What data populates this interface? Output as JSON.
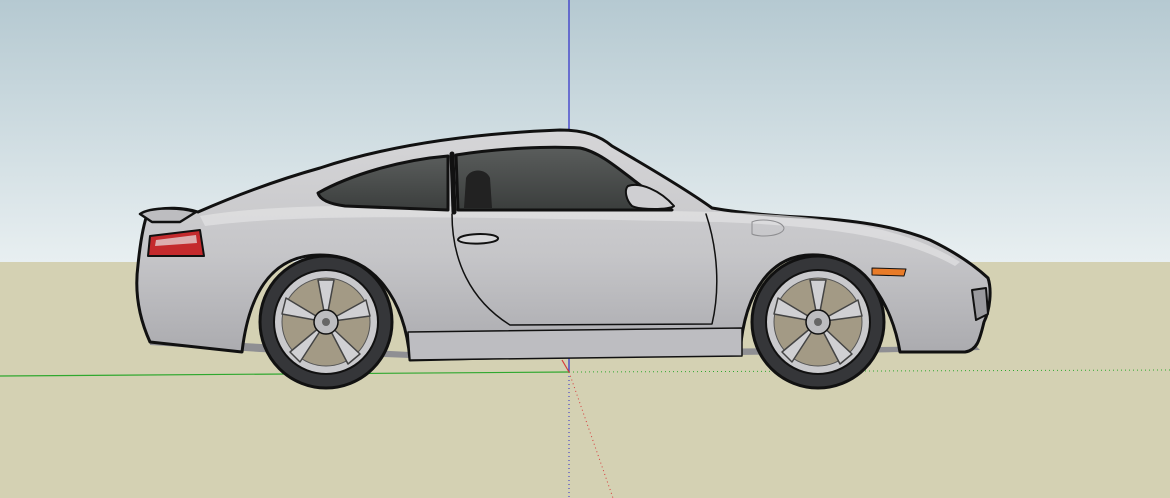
{
  "scene": {
    "model": "car-side-view",
    "sky_top_color": "#b5c9d1",
    "sky_bottom_color": "#e8eff1",
    "ground_color": "#d4d1b3",
    "car_body_color": "#c7c7c9",
    "car_body_shadow_color": "#b0b0b3",
    "glass_color": "#454847",
    "tail_light_color": "#c42a2d",
    "indicator_color": "#e87b28",
    "tire_color": "#353639",
    "rim_color": "#c9c9cc",
    "brake_disc_color": "#a39a85",
    "outline_color": "#111111"
  },
  "axes": {
    "red_axis_color": "#d73b3b",
    "green_axis_color": "#2fa82f",
    "blue_axis_color": "#2c2cc9"
  },
  "wheels": [
    "rear-wheel",
    "front-wheel"
  ]
}
